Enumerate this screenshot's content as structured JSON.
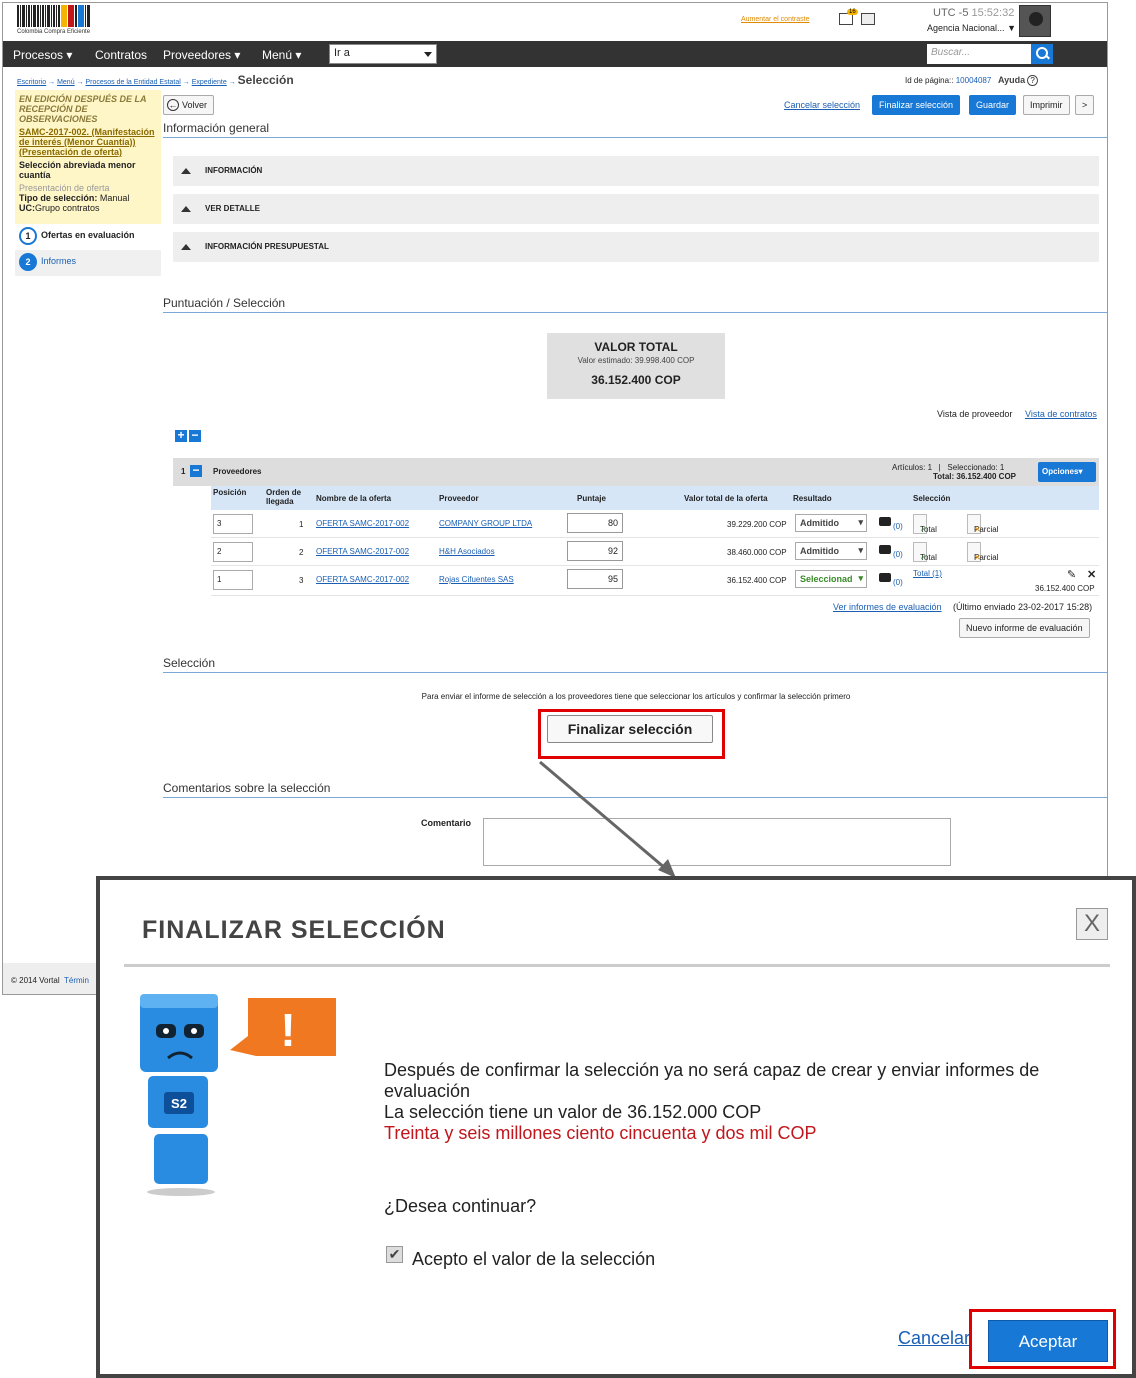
{
  "header": {
    "logo_caption": "Colombia Compra Eficiente",
    "contrast_link": "Aumentar el contraste",
    "notif_count": "16",
    "utc_label": "UTC -5",
    "utc_time": "15:52:32",
    "agency": "Agencia Nacional..."
  },
  "nav": {
    "items": [
      "Procesos",
      "Contratos",
      "Proveedores",
      "Menú"
    ],
    "goto_value": "Ir a",
    "search_placeholder": "Buscar..."
  },
  "breadcrumb": {
    "items": [
      "Escritorio",
      "Menú",
      "Procesos de la Entidad Estatal",
      "Expediente"
    ],
    "current": "Selección",
    "page_id_label": "Id de página:: ",
    "page_id": "10004087",
    "help": "Ayuda"
  },
  "sidebar": {
    "status": "EN EDICIÓN DESPUÉS DE LA RECEPCIÓN DE OBSERVACIONES",
    "process_link": "SAMC-2017-002. (Manifestación de interés (Menor Cuantía)) (Presentación de oferta)",
    "modality": "Selección abreviada menor cuantía",
    "phase": "Presentación de oferta",
    "sel_type_label": "Tipo de selección:",
    "sel_type_value": "Manual",
    "uc_label": "UC:",
    "uc_value": "Grupo contratos",
    "steps": [
      {
        "num": "1",
        "label": "Ofertas en evaluación"
      },
      {
        "num": "2",
        "label": "Informes"
      }
    ]
  },
  "toolbar": {
    "back": "Volver",
    "cancel_sel": "Cancelar selección",
    "finalize": "Finalizar selección",
    "save": "Guardar",
    "print": "Imprimir",
    "more": ">"
  },
  "general_info": {
    "title": "Información general",
    "sections": [
      "INFORMACIÓN",
      "VER DETALLE",
      "INFORMACIÓN PRESUPUESTAL"
    ]
  },
  "scoring": {
    "title": "Puntuación / Selección",
    "total_title": "VALOR TOTAL",
    "estimated": "Valor estimado: 39.998.400 COP",
    "total_value": "36.152.400 COP",
    "view_label": "Vista de proveedor",
    "view_link": "Vista de contratos",
    "group_num": "1",
    "group_label": "Proveedores",
    "articles": "Artículos: 1   |   Seleccionado: 1",
    "group_total": "Total: 36.152.400 COP",
    "options_btn": "Opciones",
    "columns": [
      "Posición",
      "Orden de llegada",
      "Nombre de la oferta",
      "Proveedor",
      "Puntaje",
      "Valor total de la oferta",
      "Resultado",
      "Selección"
    ],
    "rows": [
      {
        "position": "3",
        "order": "1",
        "offer": "OFERTA SAMC-2017-002",
        "provider": "COMPANY GROUP LTDA",
        "score": "80",
        "value": "39.229.200 COP",
        "result": "Admitido",
        "comments": "(0)",
        "total": "Total",
        "partial": "Parcial"
      },
      {
        "position": "2",
        "order": "2",
        "offer": "OFERTA SAMC-2017-002",
        "provider": "H&H Asociados",
        "score": "92",
        "value": "38.460.000 COP",
        "result": "Admitido",
        "comments": "(0)",
        "total": "Total",
        "partial": "Parcial"
      },
      {
        "position": "1",
        "order": "3",
        "offer": "OFERTA SAMC-2017-002",
        "provider": "Rojas Cifuentes SAS",
        "score": "95",
        "value": "36.152.400 COP",
        "result": "Seleccionad",
        "comments": "(0)",
        "total_link": "Total (1)",
        "sel_value": "36.152.400 COP"
      }
    ],
    "reports_link": "Ver informes de evaluación",
    "reports_last": "(Último enviado 23-02-2017 15:28)",
    "new_report": "Nuevo informe de evaluación"
  },
  "selection": {
    "title": "Selección",
    "note": "Para enviar el informe de selección a los proveedores tiene que seleccionar los artículos y confirmar la selección primero",
    "button": "Finalizar selección"
  },
  "comments": {
    "title": "Comentarios sobre la selección",
    "label": "Comentario"
  },
  "footer": {
    "copyright": "© 2014 Vortal",
    "terms": "Términ"
  },
  "modal": {
    "title": "FINALIZAR SELECCIÓN",
    "close": "X",
    "mascot_badge": "S2",
    "alert_glyph": "!",
    "line1": "Después de confirmar la selección ya no será capaz de crear y enviar informes de evaluación",
    "line2": "La selección tiene un valor de 36.152.000 COP",
    "line3": "Treinta y seis millones ciento cincuenta y dos mil COP",
    "question": "¿Desea continuar?",
    "checkbox_label": "Acepto el valor de la selección",
    "cancel": "Cancelar",
    "accept": "Aceptar"
  },
  "colors": {
    "accent": "#1878d6",
    "navbar": "#333333",
    "highlight": "#e00000",
    "warning_text": "#c0161c"
  }
}
